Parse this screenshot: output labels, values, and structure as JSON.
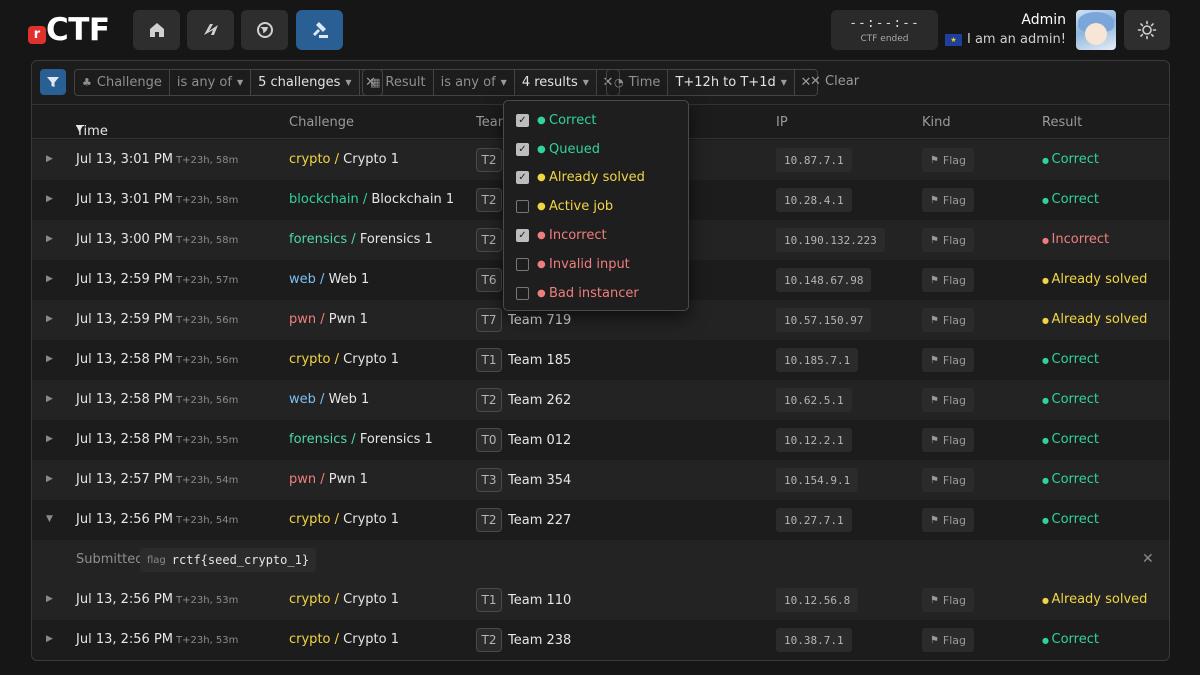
{
  "app": {
    "logo_letter": "r",
    "logo_text": "CTF"
  },
  "nav": {
    "buttons": [
      {
        "name": "home-icon"
      },
      {
        "name": "pennant-icon"
      },
      {
        "name": "globe-icon"
      },
      {
        "name": "gavel-icon"
      }
    ]
  },
  "ctf_status": {
    "time": "--:--:--",
    "label": "CTF ended"
  },
  "user": {
    "name": "Admin",
    "subtitle": "I am an admin!",
    "flag": "eu-flag"
  },
  "filters": {
    "challenge": {
      "field": "Challenge",
      "op": "is any of",
      "value": "5 challenges"
    },
    "result": {
      "field": "Result",
      "op": "is any of",
      "value": "4 results"
    },
    "time": {
      "field": "Time",
      "value": "T+12h to T+1d"
    },
    "clear_label": "Clear"
  },
  "table": {
    "headers": {
      "time": "Time",
      "challenge": "Challenge",
      "team": "Team",
      "ip": "IP",
      "kind": "Kind",
      "result": "Result"
    },
    "rows": [
      {
        "time": "Jul 13, 3:01 PM",
        "rel": "T+23h, 58m",
        "cat": "crypto",
        "sep": "/",
        "chal": "Crypto 1",
        "tb": "T2",
        "team": "",
        "ip": "10.87.7.1",
        "kind": "Flag",
        "result": "Correct"
      },
      {
        "time": "Jul 13, 3:01 PM",
        "rel": "T+23h, 58m",
        "cat": "blockchain",
        "sep": "/",
        "chal": "Blockchain 1",
        "tb": "T2",
        "team": "",
        "ip": "10.28.4.1",
        "kind": "Flag",
        "result": "Correct"
      },
      {
        "time": "Jul 13, 3:00 PM",
        "rel": "T+23h, 58m",
        "cat": "forensics",
        "sep": "/",
        "chal": "Forensics 1",
        "tb": "T2",
        "team": "",
        "ip": "10.190.132.223",
        "kind": "Flag",
        "result": "Incorrect"
      },
      {
        "time": "Jul 13, 2:59 PM",
        "rel": "T+23h, 57m",
        "cat": "web",
        "sep": "/",
        "chal": "Web 1",
        "tb": "T6",
        "team": "",
        "ip": "10.148.67.98",
        "kind": "Flag",
        "result": "Already solved"
      },
      {
        "time": "Jul 13, 2:59 PM",
        "rel": "T+23h, 56m",
        "cat": "pwn",
        "sep": "/",
        "chal": "Pwn 1",
        "tb": "T7",
        "team": "Team 719",
        "ip": "10.57.150.97",
        "kind": "Flag",
        "result": "Already solved"
      },
      {
        "time": "Jul 13, 2:58 PM",
        "rel": "T+23h, 56m",
        "cat": "crypto",
        "sep": "/",
        "chal": "Crypto 1",
        "tb": "T1",
        "team": "Team 185",
        "ip": "10.185.7.1",
        "kind": "Flag",
        "result": "Correct"
      },
      {
        "time": "Jul 13, 2:58 PM",
        "rel": "T+23h, 56m",
        "cat": "web",
        "sep": "/",
        "chal": "Web 1",
        "tb": "T2",
        "team": "Team 262",
        "ip": "10.62.5.1",
        "kind": "Flag",
        "result": "Correct"
      },
      {
        "time": "Jul 13, 2:58 PM",
        "rel": "T+23h, 55m",
        "cat": "forensics",
        "sep": "/",
        "chal": "Forensics 1",
        "tb": "T0",
        "team": "Team 012",
        "ip": "10.12.2.1",
        "kind": "Flag",
        "result": "Correct"
      },
      {
        "time": "Jul 13, 2:57 PM",
        "rel": "T+23h, 54m",
        "cat": "pwn",
        "sep": "/",
        "chal": "Pwn 1",
        "tb": "T3",
        "team": "Team 354",
        "ip": "10.154.9.1",
        "kind": "Flag",
        "result": "Correct"
      },
      {
        "time": "Jul 13, 2:56 PM",
        "rel": "T+23h, 54m",
        "cat": "crypto",
        "sep": "/",
        "chal": "Crypto 1",
        "tb": "T2",
        "team": "Team 227",
        "ip": "10.27.7.1",
        "kind": "Flag",
        "result": "Correct"
      },
      {
        "time": "Jul 13, 2:56 PM",
        "rel": "T+23h, 53m",
        "cat": "crypto",
        "sep": "/",
        "chal": "Crypto 1",
        "tb": "T1",
        "team": "Team 110",
        "ip": "10.12.56.8",
        "kind": "Flag",
        "result": "Already solved"
      },
      {
        "time": "Jul 13, 2:56 PM",
        "rel": "T+23h, 53m",
        "cat": "crypto",
        "sep": "/",
        "chal": "Crypto 1",
        "tb": "T2",
        "team": "Team 238",
        "ip": "10.38.7.1",
        "kind": "Flag",
        "result": "Correct"
      }
    ],
    "expanded": {
      "label": "Submitted",
      "kind": "flag",
      "value": "rctf{seed_crypto_1}"
    }
  },
  "result_options": [
    {
      "label": "Correct",
      "checked": true,
      "color": "#2fd3a0"
    },
    {
      "label": "Queued",
      "checked": true,
      "color": "#2fd3a0"
    },
    {
      "label": "Already solved",
      "checked": true,
      "color": "#f2d544"
    },
    {
      "label": "Active job",
      "checked": false,
      "color": "#f2d544"
    },
    {
      "label": "Incorrect",
      "checked": true,
      "color": "#f07e7e"
    },
    {
      "label": "Invalid input",
      "checked": false,
      "color": "#f07e7e"
    },
    {
      "label": "Bad instancer",
      "checked": false,
      "color": "#f07e7e"
    }
  ],
  "colors": {
    "accent": "#2a5f93",
    "cat_crypto": "#f2d544",
    "cat_blockchain": "#2fd3a0",
    "cat_forensics": "#4fd9a6",
    "cat_web": "#79c0f5",
    "cat_pwn": "#f07e7e",
    "res_correct": "#2fd3a0",
    "res_incorrect": "#f07e7e",
    "res_already": "#f2d544"
  }
}
